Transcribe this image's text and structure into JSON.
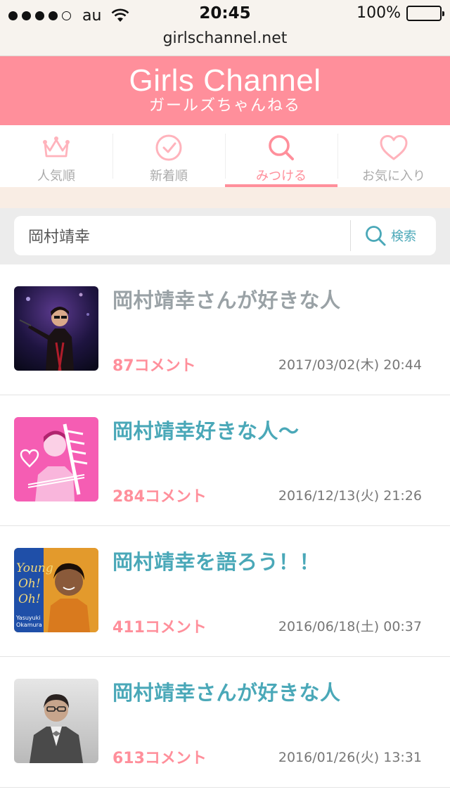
{
  "status_bar": {
    "carrier": "au",
    "time": "20:45",
    "battery": "100%",
    "url": "girlschannel.net"
  },
  "header": {
    "logo": "Girls Channel",
    "logo_sub": "ガールズちゃんねる"
  },
  "nav": {
    "tabs": [
      {
        "label": "人気順",
        "icon": "crown-icon"
      },
      {
        "label": "新着順",
        "icon": "clock-icon"
      },
      {
        "label": "みつける",
        "icon": "search-icon"
      },
      {
        "label": "お気に入り",
        "icon": "heart-icon"
      }
    ],
    "active_index": 2
  },
  "search": {
    "value": "岡村靖幸",
    "button_label": "検索"
  },
  "results": [
    {
      "title": "岡村靖幸さんが好きな人",
      "comments": "87コメント",
      "date": "2017/03/02(木) 20:44",
      "visited": true
    },
    {
      "title": "岡村靖幸好きな人〜",
      "comments": "284コメント",
      "date": "2016/12/13(火) 21:26",
      "visited": false
    },
    {
      "title": "岡村靖幸を語ろう！！",
      "comments": "411コメント",
      "date": "2016/06/18(土) 00:37",
      "visited": false
    },
    {
      "title": "岡村靖幸さんが好きな人",
      "comments": "613コメント",
      "date": "2016/01/26(火) 13:31",
      "visited": false
    }
  ],
  "thumbnails": {
    "album_text": [
      "Young",
      "Oh!",
      "Oh!",
      "Yasuyuki",
      "Okamura"
    ]
  },
  "colors": {
    "brand_pink": "#ff8f9b",
    "link_teal": "#4aa8b8",
    "visited_gray": "#9aa2a6"
  }
}
